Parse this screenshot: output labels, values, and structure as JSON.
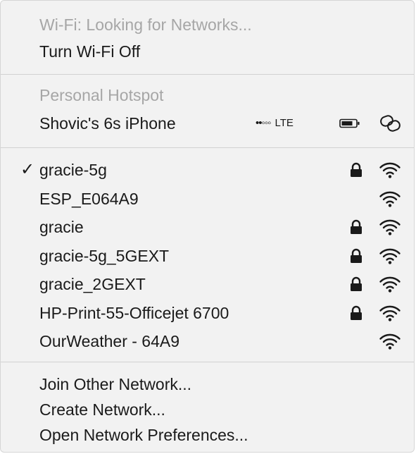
{
  "wifi_status": {
    "status_text": "Wi-Fi: Looking for Networks...",
    "turn_off_label": "Turn Wi-Fi Off"
  },
  "hotspot": {
    "section_label": "Personal Hotspot",
    "device_name": "Shovic's 6s iPhone",
    "signal_dots": "••◦◦◦",
    "network_type": "LTE",
    "signal_bars_filled": 2,
    "signal_bars_total": 5,
    "battery_icon": "battery-icon",
    "link_icon": "link-icon"
  },
  "networks": [
    {
      "name": "gracie-5g",
      "connected": true,
      "secured": true
    },
    {
      "name": "ESP_E064A9",
      "connected": false,
      "secured": false
    },
    {
      "name": "gracie",
      "connected": false,
      "secured": true
    },
    {
      "name": "gracie-5g_5GEXT",
      "connected": false,
      "secured": true
    },
    {
      "name": "gracie_2GEXT",
      "connected": false,
      "secured": true
    },
    {
      "name": "HP-Print-55-Officejet 6700",
      "connected": false,
      "secured": true
    },
    {
      "name": "OurWeather - 64A9",
      "connected": false,
      "secured": false
    }
  ],
  "check_mark": "✓",
  "actions": {
    "join_other": "Join Other Network...",
    "create": "Create Network...",
    "open_prefs": "Open Network Preferences..."
  },
  "colors": {
    "menu_background": "#f2f2f2",
    "disabled_text": "#a6a6a6",
    "text": "#1a1a1a",
    "separator": "#d2d2d2"
  }
}
